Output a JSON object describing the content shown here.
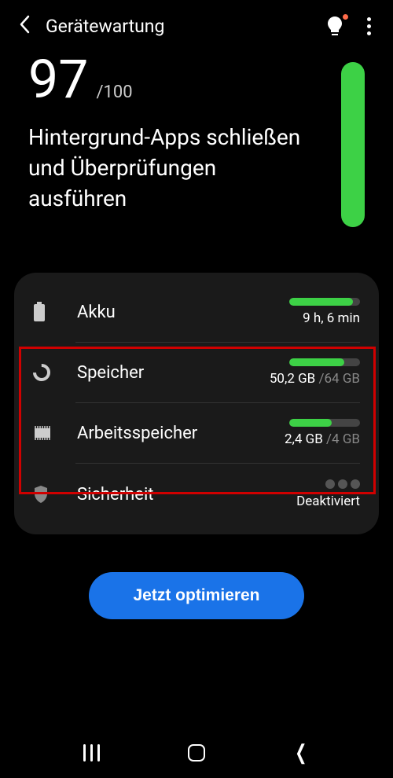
{
  "header": {
    "title": "Gerätewartung"
  },
  "score": {
    "value": "97",
    "max": "/100",
    "description": "Hintergrund-Apps schließen und Überprüfungen ausführen"
  },
  "rows": {
    "battery": {
      "label": "Akku",
      "value": "9 h, 6 min",
      "fill_pct": 90
    },
    "storage": {
      "label": "Speicher",
      "used": "50,2 GB ",
      "total": "/64 GB",
      "fill_pct": 78
    },
    "memory": {
      "label": "Arbeitsspeicher",
      "used": "2,4 GB ",
      "total": "/4 GB",
      "fill_pct": 60
    },
    "security": {
      "label": "Sicherheit",
      "status": "Deaktiviert"
    }
  },
  "button": {
    "optimize": "Jetzt optimieren"
  }
}
